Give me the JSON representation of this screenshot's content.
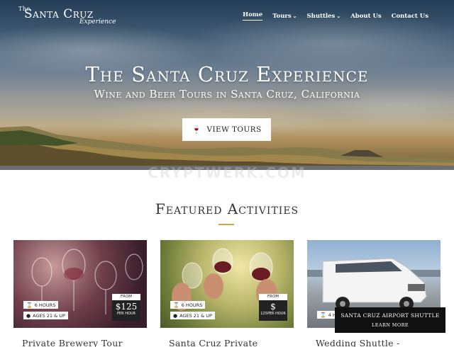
{
  "nav": {
    "logo": {
      "the": "The",
      "name": "Santa Cruz",
      "experience": "Experience"
    },
    "items": [
      {
        "label": "Home",
        "dropdown": false,
        "active": true
      },
      {
        "label": "Tours",
        "dropdown": true,
        "active": false
      },
      {
        "label": "Shuttles",
        "dropdown": true,
        "active": false
      },
      {
        "label": "About Us",
        "dropdown": false,
        "active": false
      },
      {
        "label": "Contact Us",
        "dropdown": false,
        "active": false
      }
    ]
  },
  "hero": {
    "title": "The Santa Cruz Experience",
    "subtitle": "Wine and Beer Tours in Santa Cruz, California",
    "button_label": "VIEW TOURS",
    "button_icon": "wine-glass-icon"
  },
  "watermark": "CRYPTWERK.COM",
  "featured": {
    "title": "Featured Activities",
    "accent_color": "#c9a64a",
    "cards": [
      {
        "title": "Private Brewery Tour",
        "duration": "6 HOURS",
        "ages": "AGES 21 & UP",
        "price_from": "FROM",
        "price": "$125",
        "price_unit": "PER HOUR"
      },
      {
        "title": "Santa Cruz Private",
        "duration": "6 HOURS",
        "ages": "AGES 21 & UP",
        "price_from": "FROM",
        "price": "$",
        "price_unit": "125PER HOUR"
      },
      {
        "title": "Wedding Shuttle -",
        "duration": "4 H",
        "overlay_title": "SANTA CRUZ AIRPORT SHUTTLE",
        "overlay_link": "LEARN MORE"
      }
    ]
  }
}
